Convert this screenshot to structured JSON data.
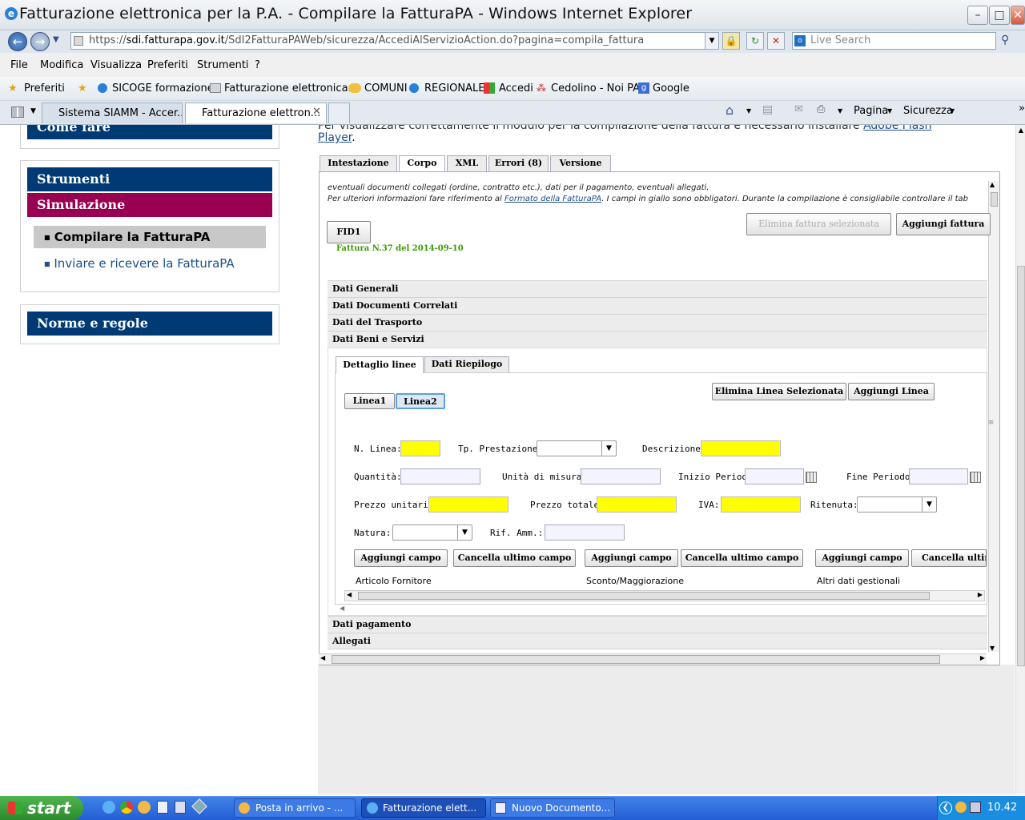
{
  "window": {
    "title": "Fatturazione elettronica per la P.A. - Compilare la FatturaPA - Windows Internet Explorer"
  },
  "address": {
    "prefix": "https://",
    "host": "sdi.fatturapa.gov.it",
    "path": "/SdI2FatturaPAWeb/sicurezza/AccediAlServizioAction.do?pagina=compila_fattura"
  },
  "search": {
    "placeholder": "Live Search"
  },
  "menu": [
    "File",
    "Modifica",
    "Visualizza",
    "Preferiti",
    "Strumenti",
    "?"
  ],
  "favorites": {
    "label": "Preferiti",
    "items": [
      "SICOGE formazione",
      "Fatturazione elettronica...",
      "COMUNI",
      "REGIONALE",
      "Accedi",
      "Cedolino - Noi PA",
      "Google"
    ]
  },
  "browser_tabs": [
    "Sistema SIAMM - Accer...",
    "Fatturazione elettron..."
  ],
  "commands": {
    "page": "Pagina",
    "security": "Sicurezza"
  },
  "sidebar": {
    "top_partial": "Come fare",
    "strumenti": "Strumenti",
    "simulazione": "Simulazione",
    "items": [
      "Compilare la FatturaPA",
      "Inviare e ricevere la FatturaPA"
    ],
    "norme": "Norme e regole"
  },
  "intro": {
    "partial_line": "Per visualizzare correttamente il modulo per la compilazione della fattura è necessario installare",
    "link": "Adobe Flash",
    "player": "Player",
    "dot": "."
  },
  "page_tabs": [
    "Intestazione",
    "Corpo",
    "XML",
    "Errori (8)",
    "Versione"
  ],
  "info": {
    "line1": "eventuali documenti collegati (ordine, contratto etc.), dati per il pagamento, eventuali allegati.",
    "line2_pre": "Per ulteriori informazioni fare riferimento al",
    "line2_link": "Formato della FatturaPA",
    "line2_post": ". I campi in giallo sono obbligatori. Durante la compilazione è consigliabile controllare il tab"
  },
  "invoice": {
    "id_button": "FID1",
    "caption": "Fattura N.37 del 2014-09-10",
    "delete": "Elimina fattura selezionata",
    "add": "Aggiungi fattura"
  },
  "sections": [
    "Dati Generali",
    "Dati Documenti Correlati",
    "Dati del Trasporto",
    "Dati Beni e Servizi"
  ],
  "sections_bottom": [
    "Dati pagamento",
    "Allegati"
  ],
  "inner_tabs": [
    "Dettaglio linee",
    "Dati Riepilogo"
  ],
  "lines": [
    "Linea1",
    "Linea2"
  ],
  "line_buttons": {
    "delete": "Elimina Linea Selezionata",
    "add": "Aggiungi Linea"
  },
  "fields": {
    "n_linea": "N. Linea:",
    "tp_prestazione": "Tp. Prestazione:",
    "descrizione": "Descrizione:",
    "quantita": "Quantità:",
    "unita": "Unità di misura:",
    "inizio": "Inizio Periodo:",
    "fine": "Fine Periodo:",
    "prezzo_unitario": "Prezzo unitario:",
    "prezzo_totale": "Prezzo totale:",
    "iva": "IVA:",
    "ritenuta": "Ritenuta:",
    "natura": "Natura:",
    "rif_amm": "Rif. Amm.:"
  },
  "field_buttons": [
    "Aggiungi campo",
    "Cancella ultimo campo",
    "Aggiungi campo",
    "Cancella ultimo campo",
    "Aggiungi campo",
    "Cancella ultimo"
  ],
  "groups": [
    "Articolo Fornitore",
    "Sconto/Maggiorazione",
    "Altri dati gestionali"
  ],
  "taskbar": {
    "start": "start",
    "tasks": [
      "Posta in arrivo - ...",
      "Fatturazione elett...",
      "Nuovo Documento..."
    ],
    "clock": "10.42"
  }
}
